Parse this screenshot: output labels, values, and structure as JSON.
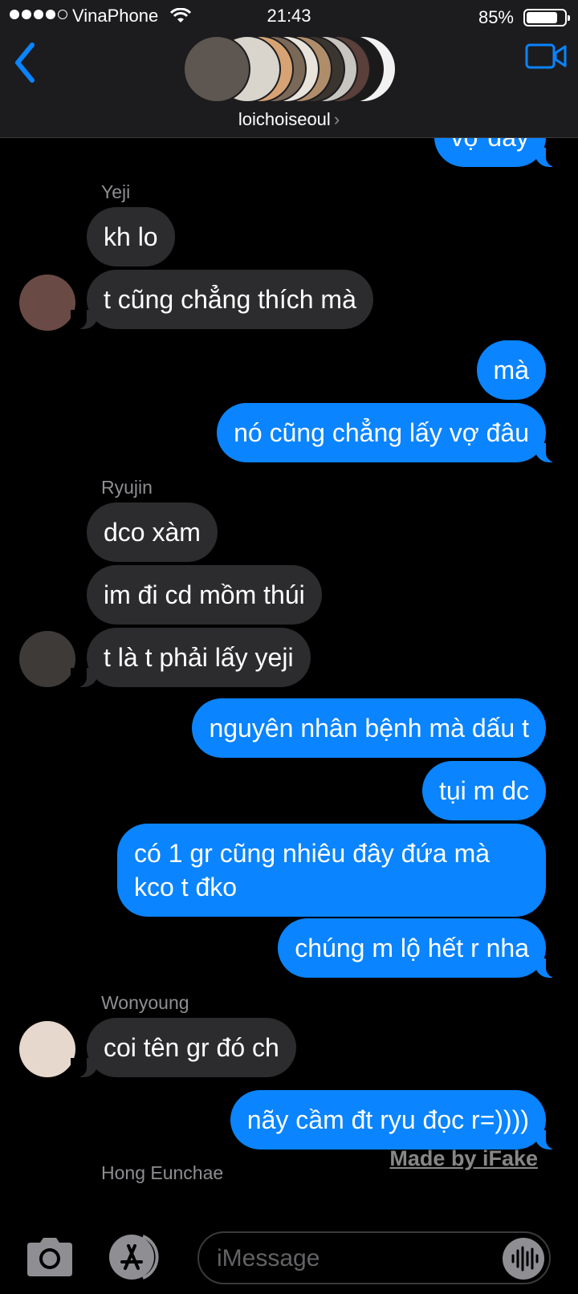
{
  "status_bar": {
    "carrier": "VinaPhone",
    "time": "21:43",
    "battery_percent": "85%",
    "battery_level": 0.85,
    "signal_bars": 4
  },
  "header": {
    "group_name": "loichoiseoul",
    "chevron": "›",
    "back_icon": "chevron-left-icon",
    "video_icon": "video-camera-icon",
    "accent_color": "#0a84ff"
  },
  "messages": [
    {
      "dir": "out",
      "text": "vợ đây"
    },
    {
      "dir": "in",
      "sender": "Yeji",
      "text": "kh lo"
    },
    {
      "dir": "in",
      "text": "t cũng chẳng thích mà"
    },
    {
      "dir": "out",
      "text": "mà"
    },
    {
      "dir": "out",
      "text": "nó cũng chẳng lấy vợ đâu"
    },
    {
      "dir": "in",
      "sender": "Ryujin",
      "text": "dco xàm"
    },
    {
      "dir": "in",
      "text": "im đi cd mồm thúi"
    },
    {
      "dir": "in",
      "text": "t là t phải lấy yeji"
    },
    {
      "dir": "out",
      "text": "nguyên nhân bệnh mà dấu t"
    },
    {
      "dir": "out",
      "text": "tụi m dc"
    },
    {
      "dir": "out",
      "text": "có 1 gr cũng nhiêu đây đứa mà kco t đko"
    },
    {
      "dir": "out",
      "text": "chúng m lộ hết r nha"
    },
    {
      "dir": "in",
      "sender": "Wonyoung",
      "text": "coi tên gr đó ch"
    },
    {
      "dir": "out",
      "text": "nãy cầm đt ryu đọc r=))))"
    }
  ],
  "next_sender": "Hong Eunchae",
  "watermark": "Made by iFake",
  "input_bar": {
    "placeholder": "iMessage",
    "camera_icon": "camera-icon",
    "apps_icon": "app-store-icon",
    "audio_icon": "audio-waveform-icon"
  },
  "colors": {
    "outgoing_bubble": "#0a84ff",
    "incoming_bubble": "#2c2c2e",
    "sender_label": "#8e8e93",
    "header_bg": "#1c1c1e"
  }
}
